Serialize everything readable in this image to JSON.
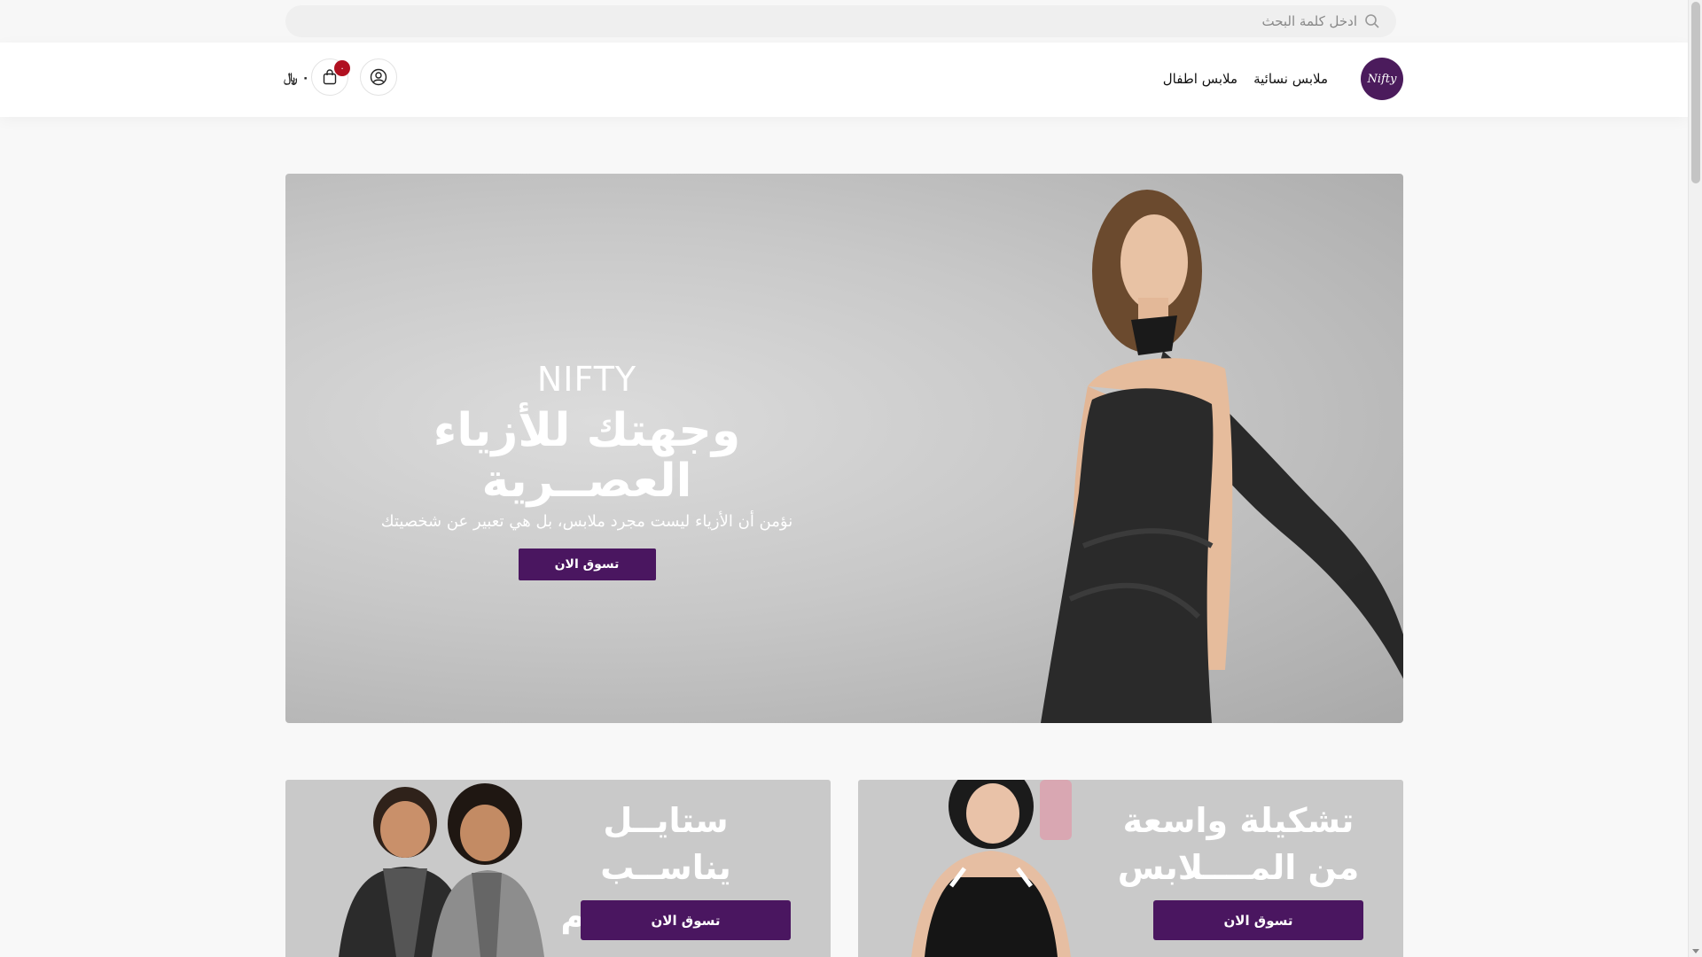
{
  "search": {
    "placeholder": "ادخل كلمة البحث"
  },
  "header": {
    "logo_text": "Nifty",
    "nav": [
      {
        "label": "ملابس نسائية"
      },
      {
        "label": "ملابس اطفال"
      }
    ],
    "cart": {
      "badge_count": "٠",
      "total": "٠ ﷼"
    }
  },
  "hero": {
    "brand": "NIFTY",
    "title": "وجهتك للأزياء العصــرية",
    "subtitle": "نؤمن أن الأزياء ليست مجرد ملابس، بل هي تعبير عن شخصيتك",
    "button_label": "تسوق الان"
  },
  "promos": [
    {
      "title_line1": "تشكيلة واسعة",
      "title_line2": "من المــــلابس",
      "button_label": "تسوق الان"
    },
    {
      "title_line1": "ستايــل يناســب",
      "title_line2": "صغاركـــــــم",
      "button_label": "تسوق الان"
    }
  ],
  "colors": {
    "brand_purple": "#4a1660",
    "badge_red": "#b01020",
    "hero_grey": "#c8c8c8"
  }
}
